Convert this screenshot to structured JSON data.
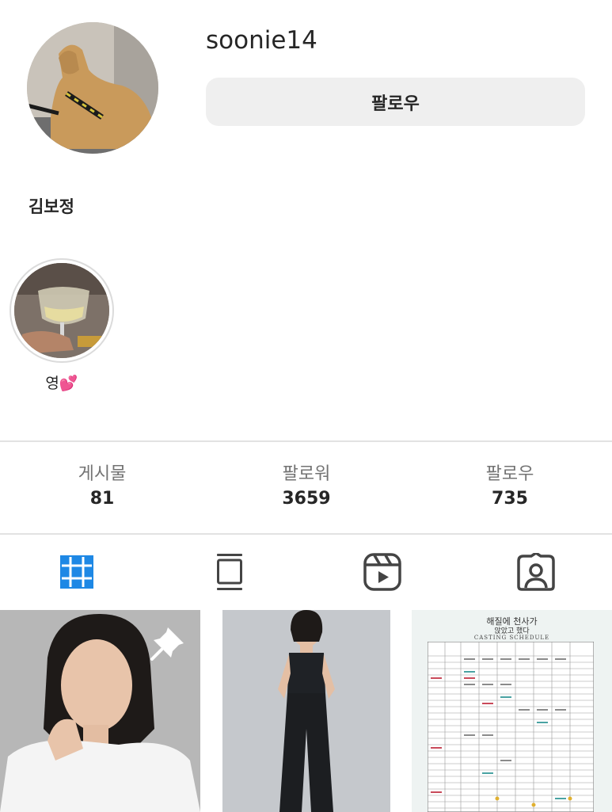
{
  "profile": {
    "username": "soonie14",
    "follow_label": "팔로우",
    "display_name": "김보정"
  },
  "highlights": [
    {
      "label": "영💕"
    }
  ],
  "stats": [
    {
      "label": "게시물",
      "value": "81"
    },
    {
      "label": "팔로워",
      "value": "3659"
    },
    {
      "label": "팔로우",
      "value": "735"
    }
  ],
  "tabs": [
    {
      "name": "grid-icon",
      "active": true
    },
    {
      "name": "feed-icon",
      "active": false
    },
    {
      "name": "reels-icon",
      "active": false
    },
    {
      "name": "tagged-icon",
      "active": false
    }
  ],
  "colors": {
    "active_tab": "#1e88e5",
    "inactive_tab": "#444444"
  },
  "posts": [
    {
      "pinned": true
    },
    {
      "pinned": false
    },
    {
      "pinned": false,
      "title_line1": "해질에 천사가",
      "title_line2": "앉았고 했다",
      "subtitle": "CASTING SCHEDULE"
    }
  ]
}
